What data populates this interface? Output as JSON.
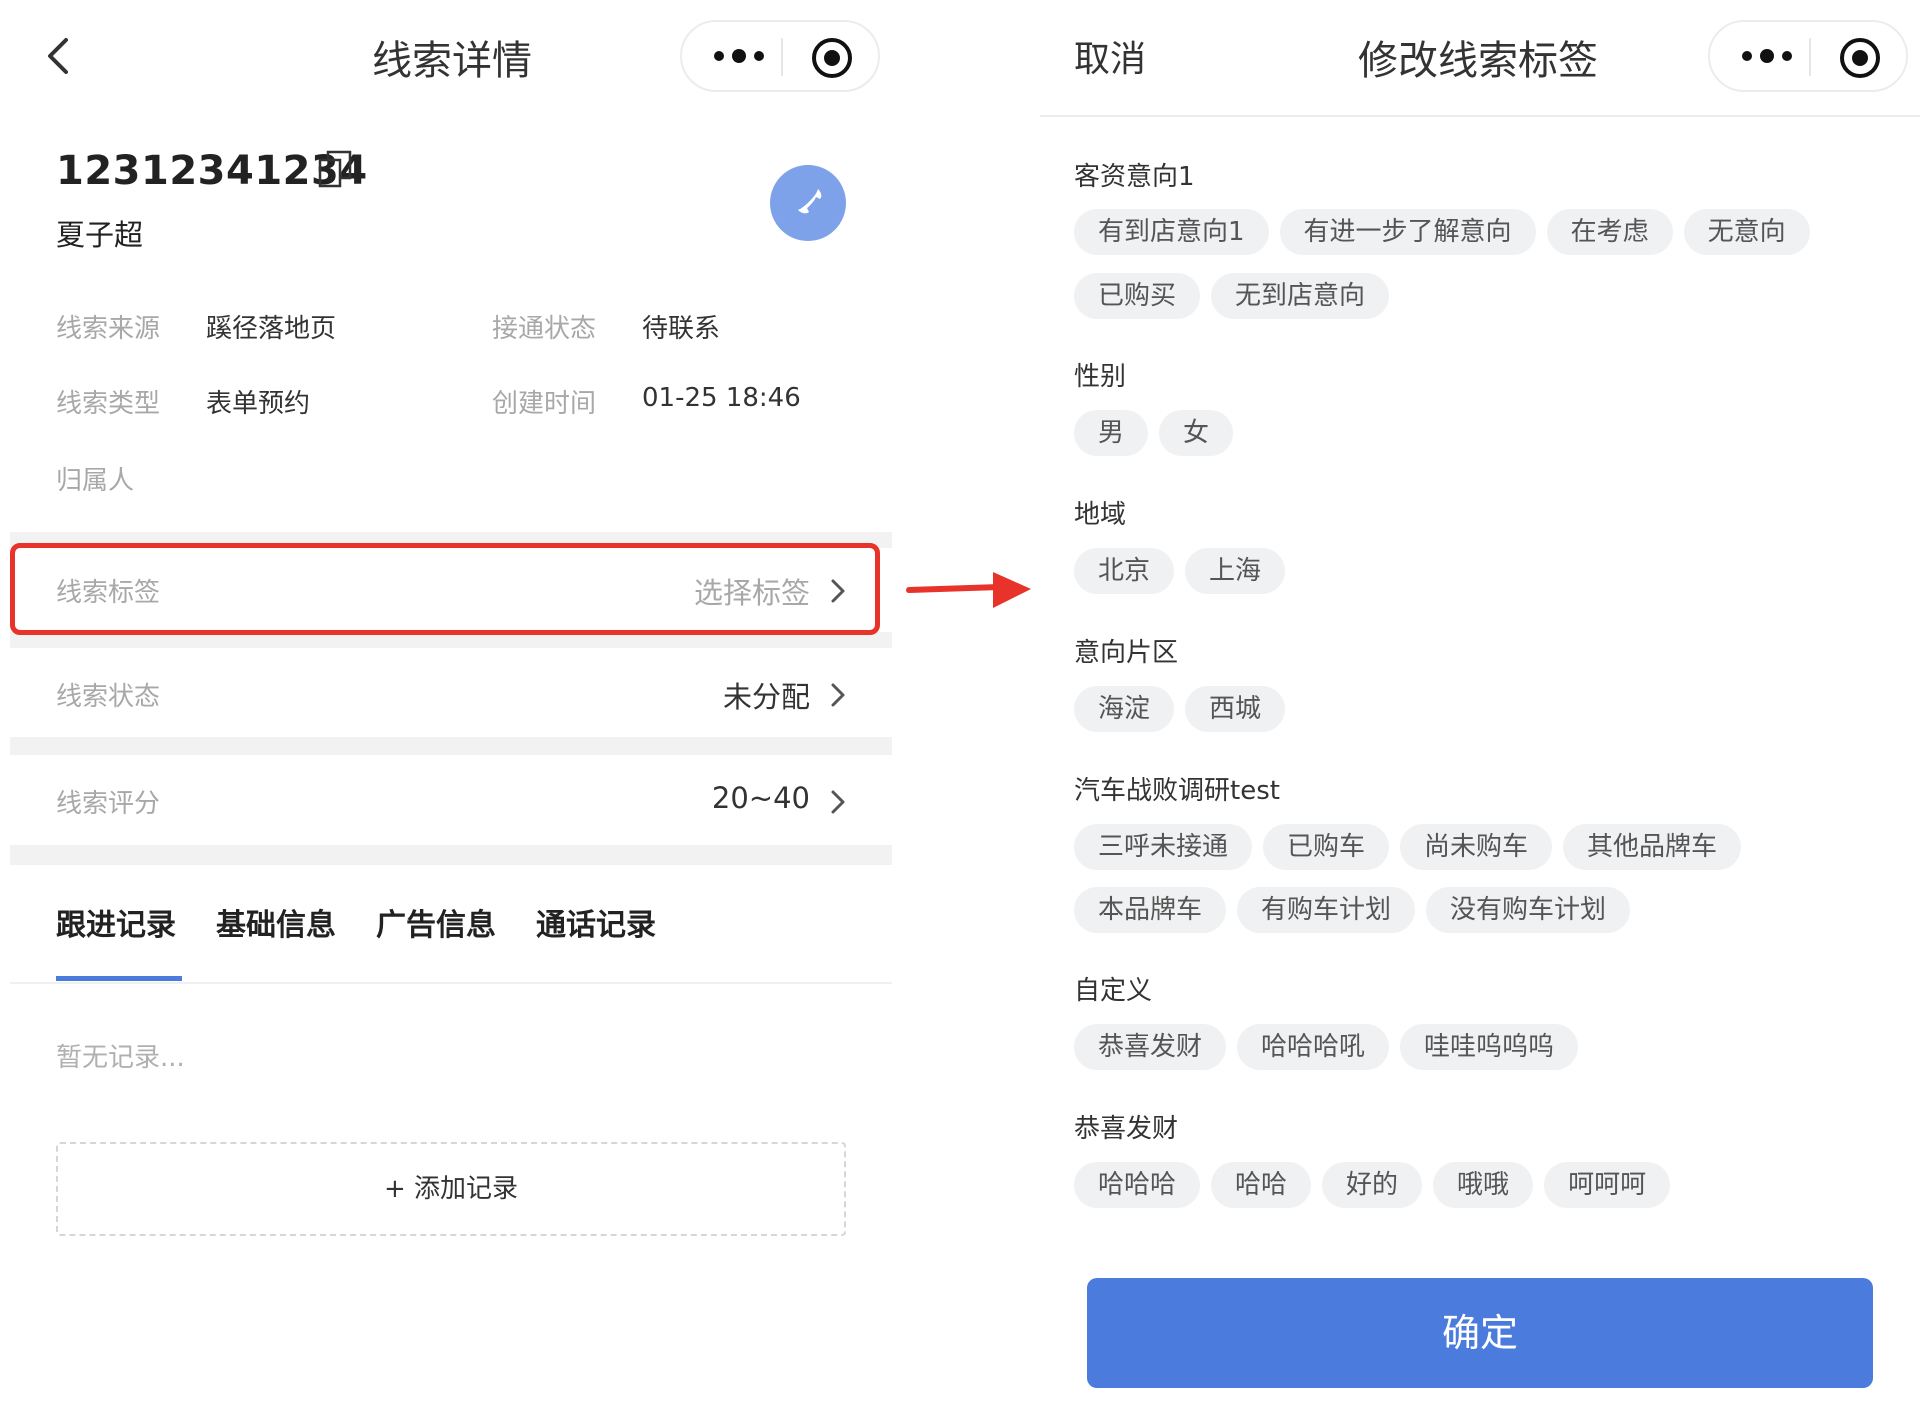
{
  "left": {
    "nav_title": "线索详情",
    "phone": "12312341234",
    "name": "夏子超",
    "info": {
      "source_label": "线索来源",
      "source_value": "蹊径落地页",
      "connect_label": "接通状态",
      "connect_value": "待联系",
      "type_label": "线索类型",
      "type_value": "表单预约",
      "created_label": "创建时间",
      "created_value": "01-25 18:46",
      "owner_label": "归属人"
    },
    "rows": {
      "tags_label": "线索标签",
      "tags_value": "选择标签",
      "status_label": "线索状态",
      "status_value": "未分配",
      "score_label": "线索评分",
      "score_value": "20~40"
    },
    "tabs": [
      "跟进记录",
      "基础信息",
      "广告信息",
      "通话记录"
    ],
    "empty_text": "暂无记录...",
    "add_button": "+ 添加记录"
  },
  "right": {
    "cancel": "取消",
    "nav_title": "修改线索标签",
    "sections": [
      {
        "title": "客资意向1",
        "tags": [
          "有到店意向1",
          "有进一步了解意向",
          "在考虑",
          "无意向",
          "已购买",
          "无到店意向"
        ]
      },
      {
        "title": "性别",
        "tags": [
          "男",
          "女"
        ]
      },
      {
        "title": "地域",
        "tags": [
          "北京",
          "上海"
        ]
      },
      {
        "title": "意向片区",
        "tags": [
          "海淀",
          "西城"
        ]
      },
      {
        "title": "汽车战败调研test",
        "tags": [
          "三呼未接通",
          "已购车",
          "尚未购车",
          "其他品牌车",
          "本品牌车",
          "有购车计划",
          "没有购车计划"
        ]
      },
      {
        "title": "自定义",
        "tags": [
          "恭喜发财",
          "哈哈哈吼",
          "哇哇呜呜呜"
        ]
      },
      {
        "title": "恭喜发财",
        "tags": [
          "哈哈哈",
          "哈哈",
          "好的",
          "哦哦",
          "呵呵呵"
        ]
      }
    ],
    "confirm": "确定"
  },
  "colors": {
    "accent": "#4b7bdc",
    "highlight": "#e8332a",
    "call_button": "#7ea2ea",
    "tag_bg": "#f0f1f2"
  },
  "icons": [
    "chevron-left-icon",
    "more-dots-icon",
    "target-icon",
    "copy-icon",
    "phone-icon",
    "chevron-right-icon",
    "red-arrow-icon"
  ]
}
